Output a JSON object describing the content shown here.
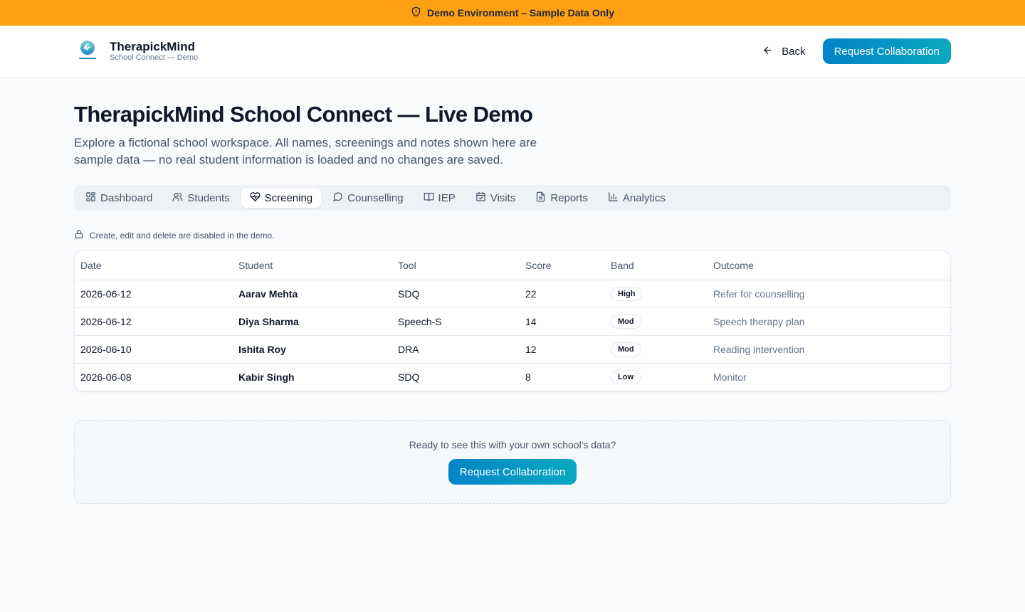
{
  "banner": {
    "icon": "shield-alert-icon",
    "text": "Demo Environment – Sample Data Only"
  },
  "header": {
    "brand_name": "TherapickMind",
    "brand_sub": "School Connect — Demo",
    "back_label": "Back",
    "cta_label": "Request Collaboration"
  },
  "page": {
    "title": "TherapickMind School Connect — Live Demo",
    "description": "Explore a fictional school workspace. All names, screenings and notes shown here are sample data — no real student information is loaded and no changes are saved."
  },
  "tabs": [
    {
      "label": "Dashboard",
      "icon": "grid-icon",
      "active": false
    },
    {
      "label": "Students",
      "icon": "users-icon",
      "active": false
    },
    {
      "label": "Screening",
      "icon": "heart-pulse-icon",
      "active": true
    },
    {
      "label": "Counselling",
      "icon": "message-icon",
      "active": false
    },
    {
      "label": "IEP",
      "icon": "book-open-icon",
      "active": false
    },
    {
      "label": "Visits",
      "icon": "calendar-check-icon",
      "active": false
    },
    {
      "label": "Reports",
      "icon": "file-text-icon",
      "active": false
    },
    {
      "label": "Analytics",
      "icon": "bar-chart-icon",
      "active": false
    }
  ],
  "notice": {
    "icon": "lock-icon",
    "text": "Create, edit and delete are disabled in the demo."
  },
  "table": {
    "headers": [
      "Date",
      "Student",
      "Tool",
      "Score",
      "Band",
      "Outcome"
    ],
    "rows": [
      [
        "2026-06-12",
        "Aarav Mehta",
        "SDQ",
        "22",
        "High",
        "Refer for counselling"
      ],
      [
        "2026-06-12",
        "Diya Sharma",
        "Speech-S",
        "14",
        "Mod",
        "Speech therapy plan"
      ],
      [
        "2026-06-10",
        "Ishita Roy",
        "DRA",
        "12",
        "Mod",
        "Reading intervention"
      ],
      [
        "2026-06-08",
        "Kabir Singh",
        "SDQ",
        "8",
        "Low",
        "Monitor"
      ]
    ]
  },
  "cta_panel": {
    "text": "Ready to see this with your own school's data?",
    "button_label": "Request Collaboration"
  },
  "colors": {
    "banner": "#ff9f12",
    "accent_start": "#0284c7",
    "accent_end": "#0aa8c0",
    "background": "#f8fafc"
  }
}
